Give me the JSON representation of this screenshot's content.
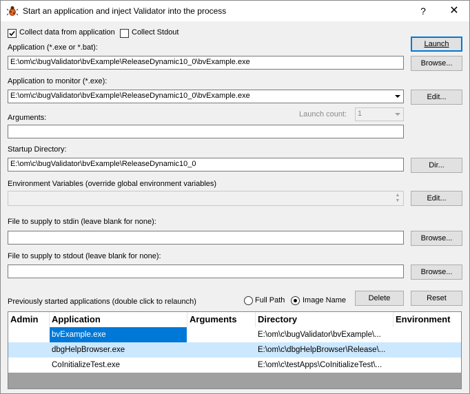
{
  "window": {
    "title": "Start an application and inject Validator into the process",
    "help_label": "?",
    "close_label": "✕"
  },
  "options": {
    "collect_data_label": "Collect data from application",
    "collect_data_checked": true,
    "collect_stdout_label": "Collect Stdout",
    "collect_stdout_checked": false
  },
  "application": {
    "label": "Application (*.exe or *.bat):",
    "value": "E:\\om\\c\\bugValidator\\bvExample\\ReleaseDynamic10_0\\bvExample.exe",
    "browse_label": "Browse..."
  },
  "launch_label": "Launch",
  "monitor": {
    "label": "Application to monitor (*.exe):",
    "value": "E:\\om\\c\\bugValidator\\bvExample\\ReleaseDynamic10_0\\bvExample.exe",
    "edit_label": "Edit..."
  },
  "arguments": {
    "label": "Arguments:",
    "value": "",
    "launch_count_label": "Launch count:",
    "launch_count_value": "1"
  },
  "startup": {
    "label": "Startup Directory:",
    "value": "E:\\om\\c\\bugValidator\\bvExample\\ReleaseDynamic10_0",
    "dir_label": "Dir..."
  },
  "environment": {
    "label": "Environment Variables (override global environment variables)",
    "value": "",
    "edit_label": "Edit..."
  },
  "stdin": {
    "label": "File to supply to stdin (leave blank for none):",
    "value": "",
    "browse_label": "Browse..."
  },
  "stdout": {
    "label": "File to supply to stdout (leave blank for none):",
    "value": "",
    "browse_label": "Browse..."
  },
  "previous": {
    "label": "Previously started applications (double click to relaunch)",
    "full_path_label": "Full Path",
    "image_name_label": "Image Name",
    "selected_mode": "Image Name",
    "delete_label": "Delete",
    "reset_label": "Reset",
    "columns": [
      "Admin",
      "Application",
      "Arguments",
      "Directory",
      "Environment"
    ],
    "rows": [
      {
        "admin": "",
        "application": "bvExample.exe",
        "arguments": "",
        "directory": "E:\\om\\c\\bugValidator\\bvExample\\...",
        "environment": ""
      },
      {
        "admin": "",
        "application": "dbgHelpBrowser.exe",
        "arguments": "",
        "directory": "E:\\om\\c\\dbgHelpBrowser\\Release\\...",
        "environment": ""
      },
      {
        "admin": "",
        "application": "CoInitializeTest.exe",
        "arguments": "",
        "directory": "E:\\om\\c\\testApps\\CoInitializeTest\\...",
        "environment": ""
      }
    ]
  },
  "colors": {
    "selection": "#0078d7",
    "row_highlight": "#cce8ff",
    "default_button_border": "#0078d7"
  }
}
